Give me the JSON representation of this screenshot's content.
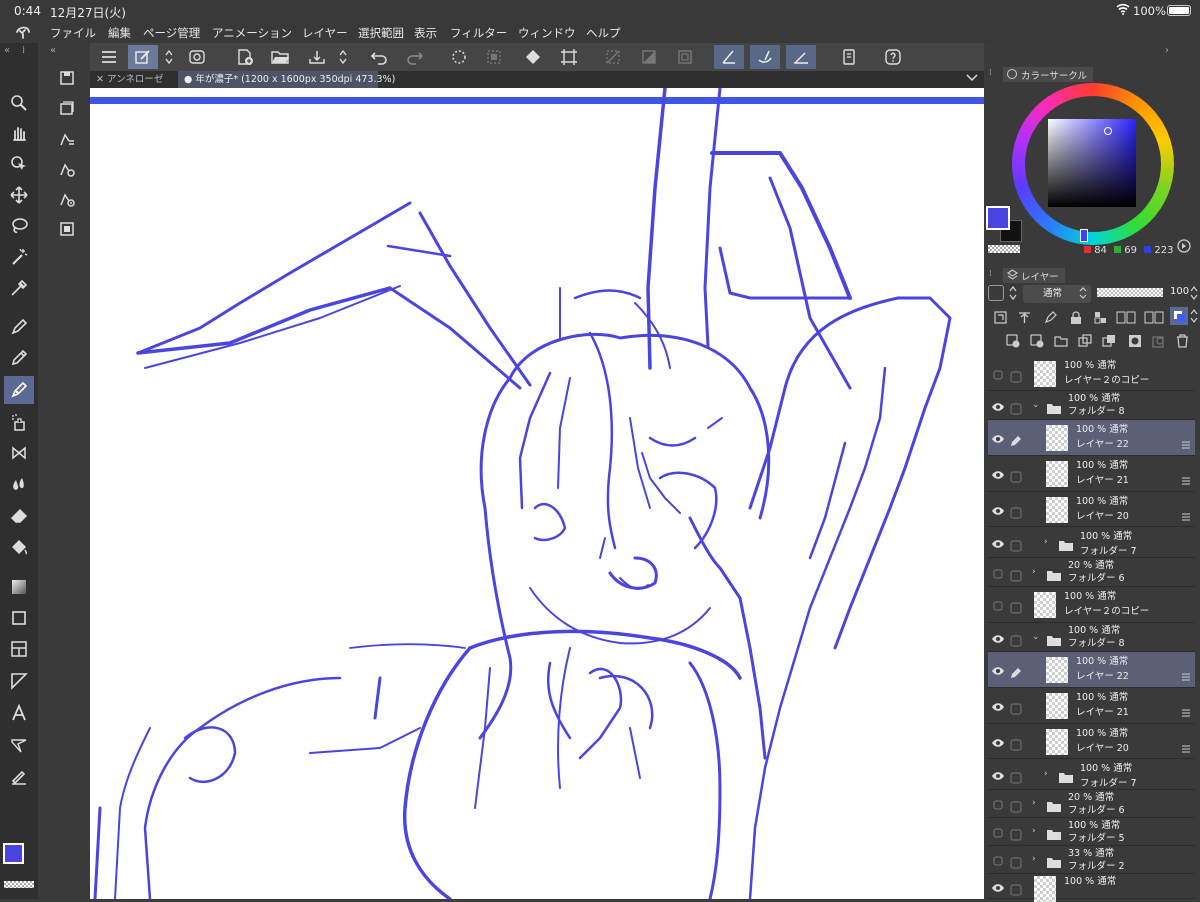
{
  "status": {
    "time": "0:44",
    "date": "12月27日(火)",
    "battery": "100%"
  },
  "menu": [
    "ファイル",
    "編集",
    "ページ管理",
    "アニメーション",
    "レイヤー",
    "選択範囲",
    "表示",
    "フィルター",
    "ウィンドウ",
    "ヘルプ"
  ],
  "tabs": [
    {
      "label": "アンネローゼ",
      "prefix": "✕"
    },
    {
      "label": "年が濃子* (1200 x 1600px 350dpi 473.3%)",
      "prefix": "●"
    }
  ],
  "color_panel": {
    "title": "カラーサークル",
    "r": "84",
    "g": "69",
    "b": "223",
    "main_color": "#4b45df"
  },
  "layer_panel": {
    "title": "レイヤー",
    "blend_mode": "通常",
    "opacity": "100",
    "layers": [
      {
        "line1": "100 % 通常",
        "line2": "レイヤー２のコピー",
        "type": "layer",
        "visible": false,
        "selected": false,
        "indent": 0,
        "caret": ""
      },
      {
        "line1": "100 % 通常",
        "line2": "フォルダー 8",
        "type": "folder",
        "visible": true,
        "selected": false,
        "indent": 0,
        "caret": "open"
      },
      {
        "line1": "100 % 通常",
        "line2": "レイヤー 22",
        "type": "layer",
        "visible": true,
        "selected": true,
        "indent": 1,
        "caret": "",
        "pen": true
      },
      {
        "line1": "100 % 通常",
        "line2": "レイヤー 21",
        "type": "layer",
        "visible": true,
        "selected": false,
        "indent": 1,
        "caret": ""
      },
      {
        "line1": "100 % 通常",
        "line2": "レイヤー 20",
        "type": "layer",
        "visible": true,
        "selected": false,
        "indent": 1,
        "caret": ""
      },
      {
        "line1": "100 % 通常",
        "line2": "フォルダー 7",
        "type": "folder",
        "visible": true,
        "selected": false,
        "indent": 1,
        "caret": "closed"
      },
      {
        "line1": "20 % 通常",
        "line2": "フォルダー 6",
        "type": "folder",
        "visible": false,
        "selected": false,
        "indent": 0,
        "caret": "closed"
      },
      {
        "line1": "100 % 通常",
        "line2": "レイヤー２のコピー",
        "type": "layer",
        "visible": false,
        "selected": false,
        "indent": 0,
        "caret": ""
      },
      {
        "line1": "100 % 通常",
        "line2": "フォルダー 8",
        "type": "folder",
        "visible": true,
        "selected": false,
        "indent": 0,
        "caret": "open"
      },
      {
        "line1": "100 % 通常",
        "line2": "レイヤー 22",
        "type": "layer",
        "visible": true,
        "selected": true,
        "indent": 1,
        "caret": "",
        "pen": true
      },
      {
        "line1": "100 % 通常",
        "line2": "レイヤー 21",
        "type": "layer",
        "visible": true,
        "selected": false,
        "indent": 1,
        "caret": ""
      },
      {
        "line1": "100 % 通常",
        "line2": "レイヤー 20",
        "type": "layer",
        "visible": true,
        "selected": false,
        "indent": 1,
        "caret": ""
      },
      {
        "line1": "100 % 通常",
        "line2": "フォルダー 7",
        "type": "folder",
        "visible": true,
        "selected": false,
        "indent": 1,
        "caret": "closed"
      },
      {
        "line1": "20 % 通常",
        "line2": "フォルダー 6",
        "type": "folder",
        "visible": false,
        "selected": false,
        "indent": 0,
        "caret": "closed"
      },
      {
        "line1": "100 % 通常",
        "line2": "フォルダー 5",
        "type": "folder",
        "visible": false,
        "selected": false,
        "indent": 0,
        "caret": "closed"
      },
      {
        "line1": "33 % 通常",
        "line2": "フォルダー 2",
        "type": "folder",
        "visible": false,
        "selected": false,
        "indent": 0,
        "caret": "closed"
      },
      {
        "line1": "100 % 通常",
        "line2": "",
        "type": "layer",
        "visible": true,
        "selected": false,
        "indent": 0,
        "caret": ""
      }
    ]
  }
}
